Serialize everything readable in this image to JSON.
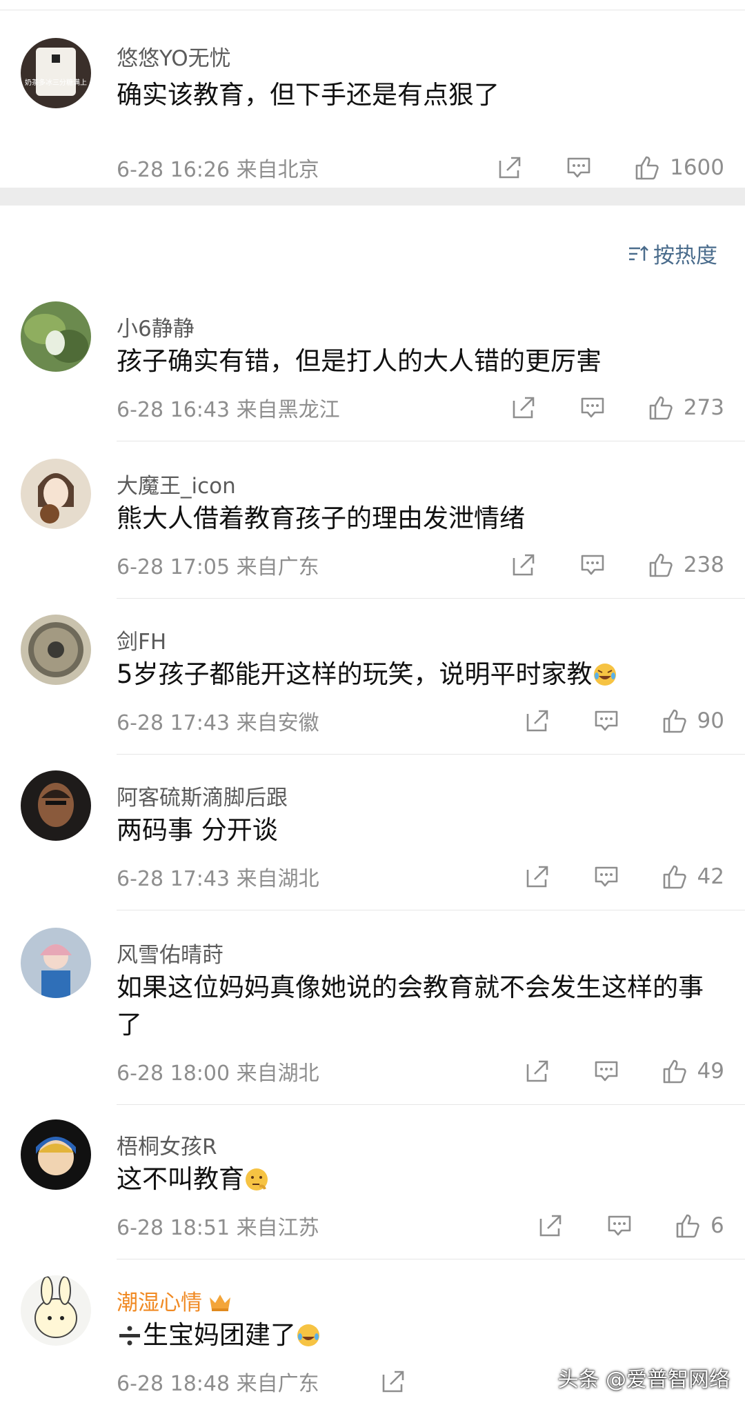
{
  "top_comment": {
    "name": "悠悠YO无忧",
    "avatar_text": "奶茶多冰三分糖满上",
    "text": "确实该教育，但下手还是有点狠了",
    "meta": "6-28 16:26 来自北京",
    "likes": "1600"
  },
  "sort": {
    "label": "按热度"
  },
  "comments": [
    {
      "name": "小6静静",
      "text": "孩子确实有错，但是打人的大人错的更厉害",
      "meta": "6-28 16:43 来自黑龙江",
      "likes": "273"
    },
    {
      "name": "大魔王_icon",
      "text": "熊大人借着教育孩子的理由发泄情绪",
      "meta": "6-28 17:05 来自广东",
      "likes": "238"
    },
    {
      "name": "剑FH",
      "text": "5岁孩子都能开这样的玩笑，说明平时家教",
      "meta": "6-28 17:43 来自安徽",
      "likes": "90"
    },
    {
      "name": "阿客硫斯滴脚后跟",
      "text": "两码事  分开谈",
      "meta": "6-28 17:43 来自湖北",
      "likes": "42"
    },
    {
      "name": "风雪佑晴莳",
      "text": "如果这位妈妈真像她说的会教育就不会发生这样的事了",
      "meta": "6-28 18:00 来自湖北",
      "likes": "49"
    },
    {
      "name": "梧桐女孩R",
      "text": "这不叫教育",
      "meta": "6-28 18:51 来自江苏",
      "likes": "6"
    },
    {
      "name": "潮湿心情",
      "text": "生宝妈团建了",
      "meta": "6-28 18:48 来自广东",
      "likes": ""
    }
  ],
  "watermark": "头条 @爱普智网络",
  "colors": {
    "vip_name": "#f08a24",
    "sort_link": "#4a6c8c",
    "meta": "#8e8e8e"
  }
}
